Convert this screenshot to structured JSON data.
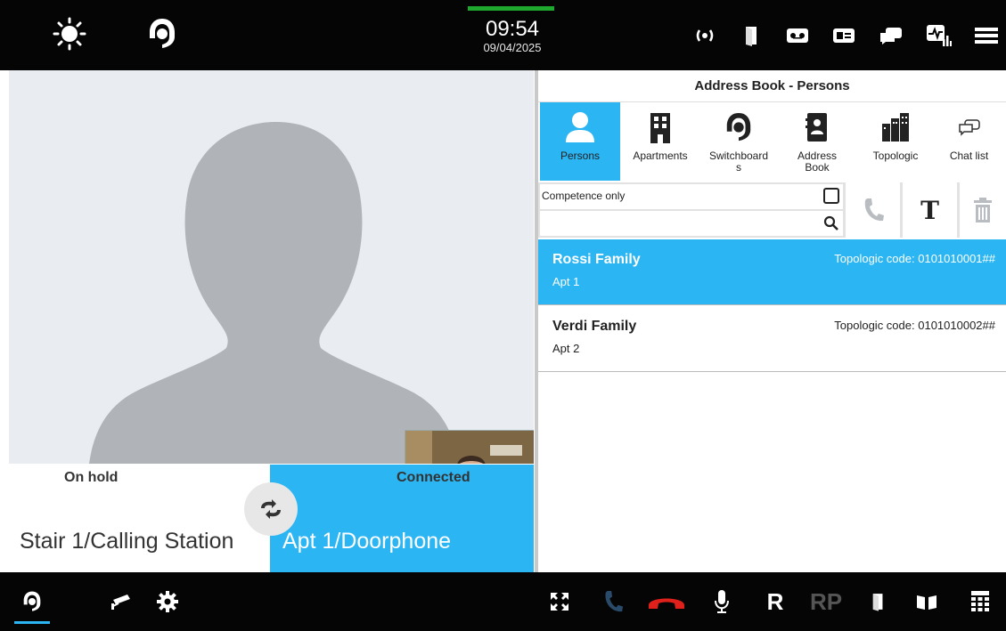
{
  "header": {
    "time": "09:54",
    "date": "09/04/2025",
    "accent_color": "#1fa82e",
    "left_icons": [
      "brightness-icon",
      "operator-headset-icon"
    ],
    "right_icons": [
      "signal-icon",
      "door-icon",
      "voicemail-icon",
      "card-icon",
      "chat-icon",
      "diagnostics-icon",
      "menu-icon"
    ]
  },
  "video": {
    "main_placeholder": "person-silhouette",
    "thumbnail": "self-view"
  },
  "calls": {
    "hold": {
      "status": "On hold",
      "name": "Stair 1/Calling Station"
    },
    "connected": {
      "status": "Connected",
      "name": "Apt 1/Doorphone",
      "color": "#2bb5f2"
    },
    "swap_icon": "swap-calls-icon"
  },
  "panel": {
    "title": "Address Book - Persons",
    "tabs": [
      {
        "label": "Persons",
        "icon": "person-icon",
        "active": true
      },
      {
        "label": "Apartments",
        "icon": "apartments-icon",
        "active": false
      },
      {
        "label": "Switchboard\ns",
        "icon": "switchboard-icon",
        "active": false
      },
      {
        "label": "Address\nBook",
        "icon": "address-book-icon",
        "active": false
      },
      {
        "label": "Topologic",
        "icon": "topologic-icon",
        "active": false
      },
      {
        "label": "Chat list",
        "icon": "chat-list-icon",
        "active": false
      }
    ],
    "filter": {
      "competence_label": "Competence only",
      "search_value": ""
    },
    "contacts": [
      {
        "name": "Rossi Family",
        "apt": "Apt 1",
        "code_label": "Topologic code:",
        "code": "0101010001##",
        "selected": true
      },
      {
        "name": "Verdi Family",
        "apt": "Apt 2",
        "code_label": "Topologic code:",
        "code": "0101010002##",
        "selected": false
      }
    ]
  },
  "footer": {
    "left_icons": [
      "operator-headset-icon",
      "cctv-camera-icon",
      "settings-icon"
    ],
    "right_icons": [
      "fullscreen-icon",
      "answer-call-icon",
      "hang-up-icon",
      "microphone-icon",
      "recall-r-button",
      "rp-button",
      "door-open-icon",
      "gate-icon",
      "keypad-icon"
    ],
    "r_label": "R",
    "rp_label": "RP"
  }
}
